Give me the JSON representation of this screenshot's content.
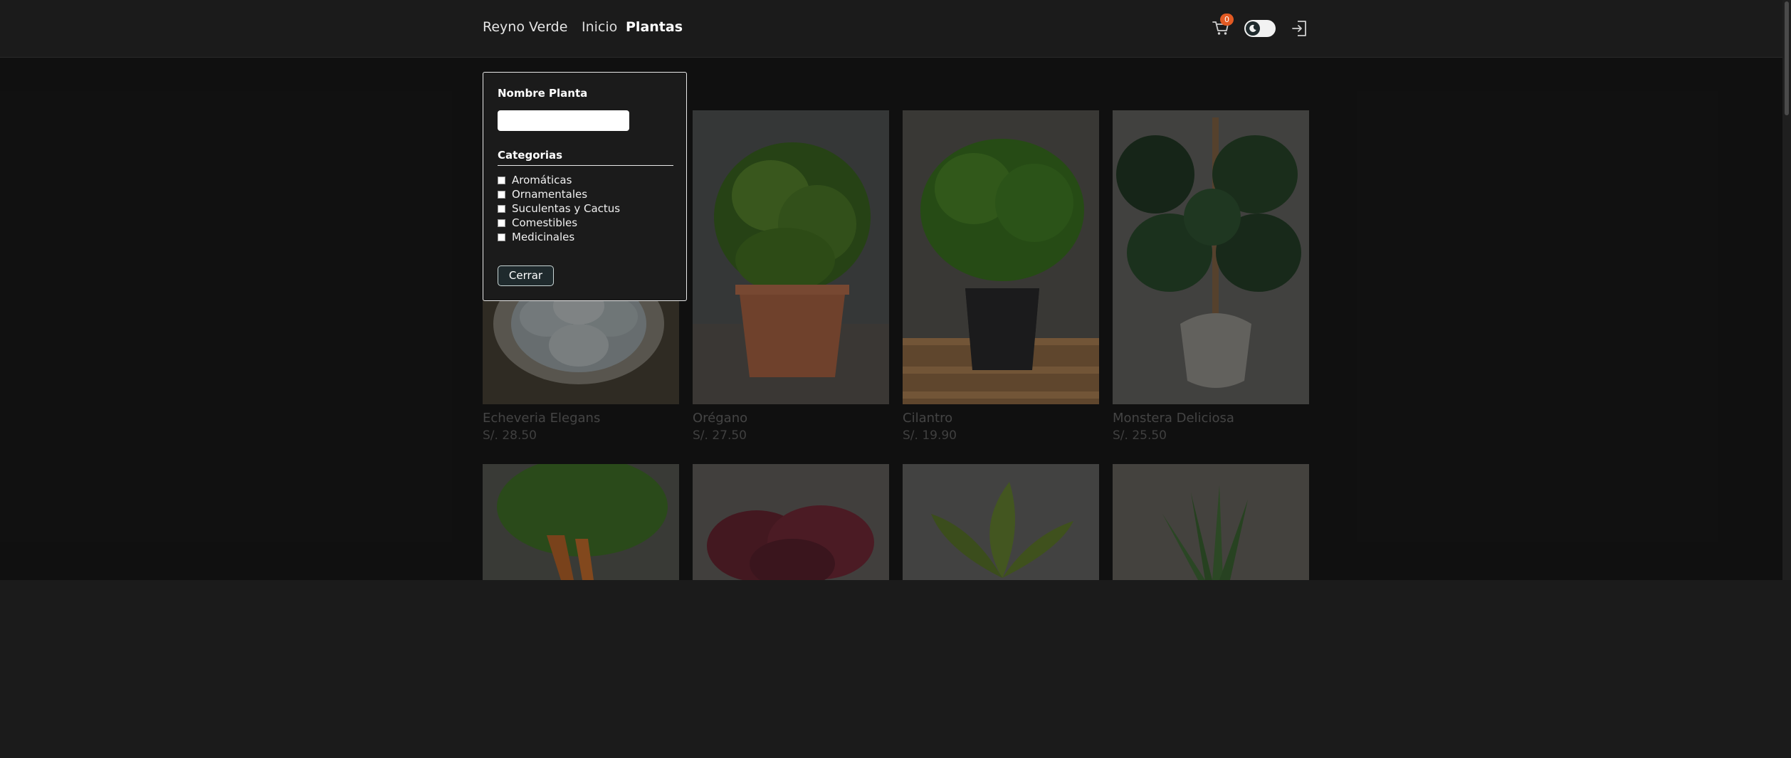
{
  "nav": {
    "brand": "Reyno Verde",
    "links": [
      "Inicio",
      "Plantas"
    ],
    "cart_count": "0",
    "icons": {
      "cart": "cart-icon",
      "theme": "moon-icon",
      "logout": "logout-icon"
    }
  },
  "filter": {
    "name_label": "Nombre Planta",
    "name_value": "",
    "categories_label": "Categorias",
    "categories": [
      "Aromáticas",
      "Ornamentales",
      "Suculentas y Cactus",
      "Comestibles",
      "Medicinales"
    ],
    "close_label": "Cerrar"
  },
  "products": [
    {
      "name": "Echeveria Elegans",
      "price": "S/. 28.50"
    },
    {
      "name": "Orégano",
      "price": "S/. 27.50"
    },
    {
      "name": "Cilantro",
      "price": "S/. 19.90"
    },
    {
      "name": "Monstera Deliciosa",
      "price": "S/. 25.50"
    }
  ],
  "colors": {
    "background": "#1b1b1b",
    "badge": "#e25a23",
    "button": "#1f2a2d"
  }
}
